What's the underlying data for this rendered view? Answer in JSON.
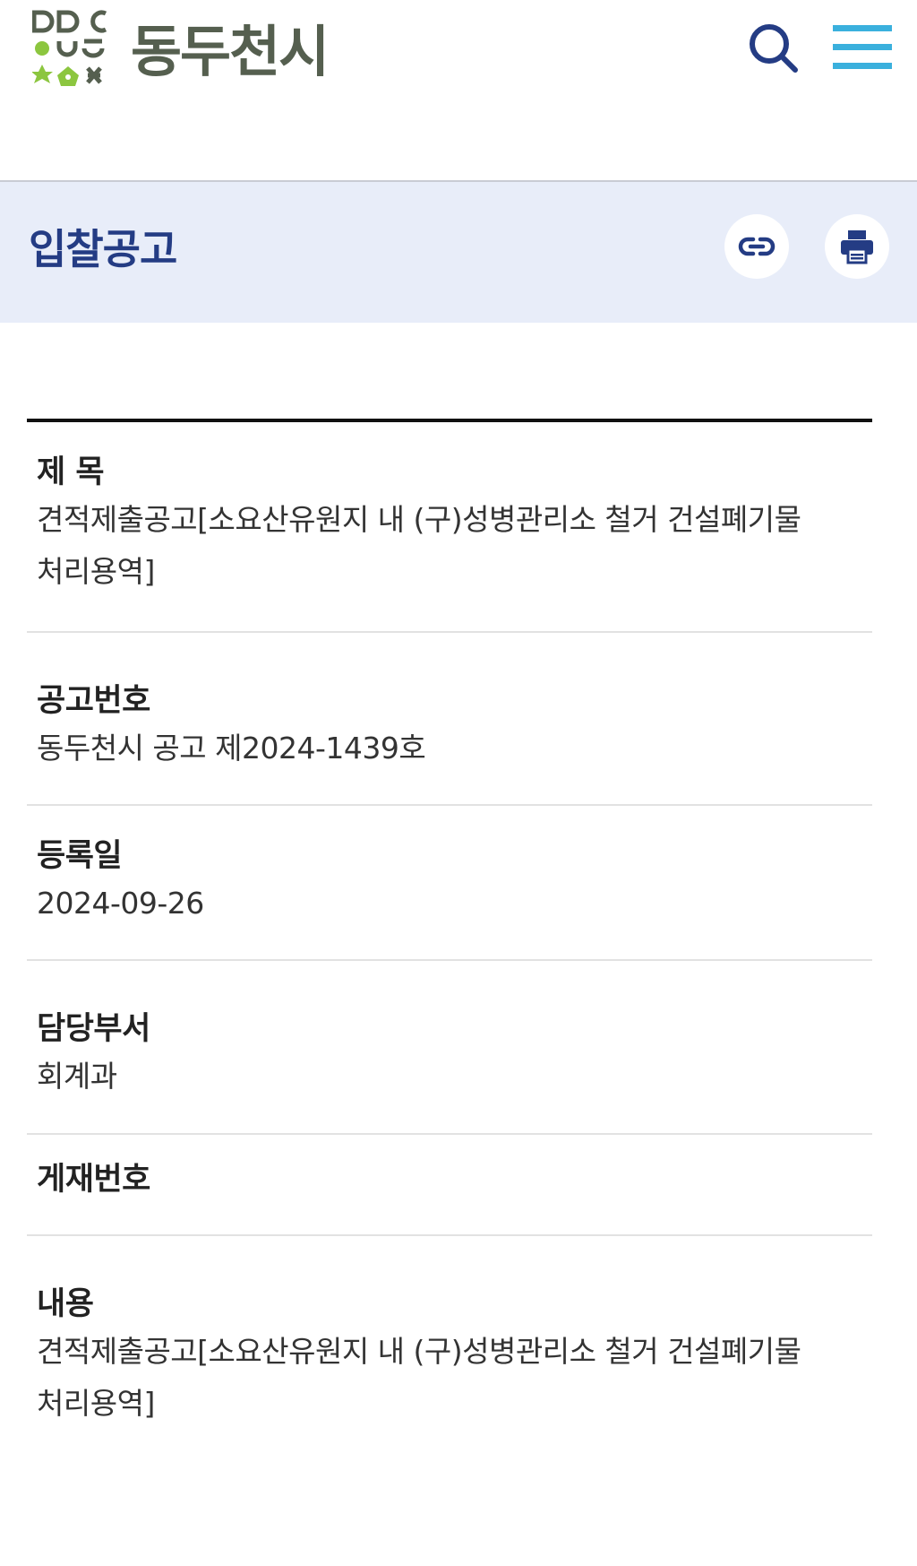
{
  "header": {
    "logo_text": "동두천시",
    "colors": {
      "logo_text": "#555f4f",
      "logo_green": "#8cc63f",
      "logo_gray": "#555f4f",
      "search_icon": "#243c84",
      "menu_icon": "#3ab0dd"
    },
    "icons": {
      "search": "search-icon",
      "menu": "hamburger-menu-icon"
    }
  },
  "title_band": {
    "title": "입찰공고",
    "background": "#e8edf9",
    "title_color": "#243c84",
    "icons": {
      "link": "link-icon",
      "print": "printer-icon"
    }
  },
  "detail": {
    "title_label": "제 목",
    "title_value": "견적제출공고[소요산유원지 내 (구)성병관리소 철거 건설폐기물 처리용역]",
    "number_label": "공고번호",
    "number_value": "동두천시 공고 제2024-1439호",
    "date_label": "등록일",
    "date_value": "2024-09-26",
    "dept_label": "담당부서",
    "dept_value": "회계과",
    "publish_label": "게재번호",
    "content_label": "내용",
    "content_value": "견적제출공고[소요산유원지 내 (구)성병관리소 철거 건설폐기물 처리용역]"
  }
}
